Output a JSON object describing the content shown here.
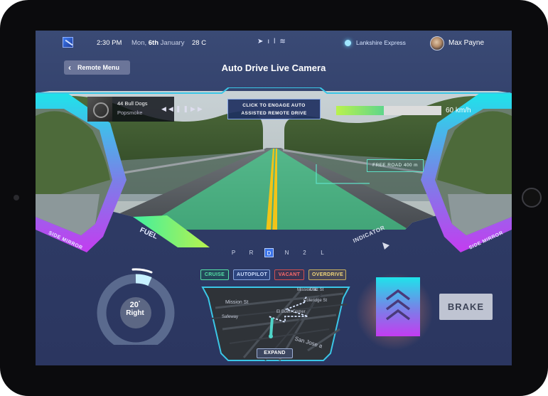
{
  "status_bar": {
    "time": "2:30 PM",
    "date_prefix": "Mon, ",
    "date_day": "6th",
    "date_suffix": " January",
    "temperature": "28 C",
    "route_name": "Lankshire Express",
    "user_name": "Max Payne",
    "icons": [
      "navigation-icon",
      "signal-icon",
      "wifi-icon"
    ]
  },
  "header": {
    "back_label": "Remote Menu",
    "title": "Auto Drive Live Camera"
  },
  "music": {
    "song": "44 Bull Dogs",
    "artist": "Popsmoke"
  },
  "camera": {
    "engage_line1": "CLICK TO ENGAGE AUTO",
    "engage_line2": "ASSISTED REMOTE DRIVE",
    "speed_label": "60 km/h",
    "speed_fraction": 0.45,
    "free_road_label": "FREE ROAD 400 m",
    "side_mirror_left": "SIDE MIRROR",
    "side_mirror_right": "SIDE MIRROR",
    "fuel_label": "FUEL",
    "indicator_label": "INDICATOR"
  },
  "gears": {
    "items": [
      "P",
      "R",
      "D",
      "N",
      "2",
      "L"
    ],
    "selected": "D"
  },
  "modes": {
    "cruise": "CRUISE",
    "autopilot": "AUTOPILOT",
    "vacant": "VACANT",
    "overdrive": "OVERDRIVE"
  },
  "map": {
    "streets": [
      "Mission St",
      "Safeway",
      "El Buen Comer",
      "San Jose a",
      "Mission St",
      "Diaz St",
      "Coleridge St"
    ],
    "expand_label": "EXPAND"
  },
  "steering": {
    "degrees": "20",
    "degree_sign": "°",
    "direction": "Right"
  },
  "controls": {
    "brake_label": "BRAKE"
  },
  "colors": {
    "accent_cyan": "#1fe3ea",
    "accent_purple": "#c43cf0",
    "screen_bg": "#2f3c66",
    "active_gear": "#3a72e8"
  }
}
